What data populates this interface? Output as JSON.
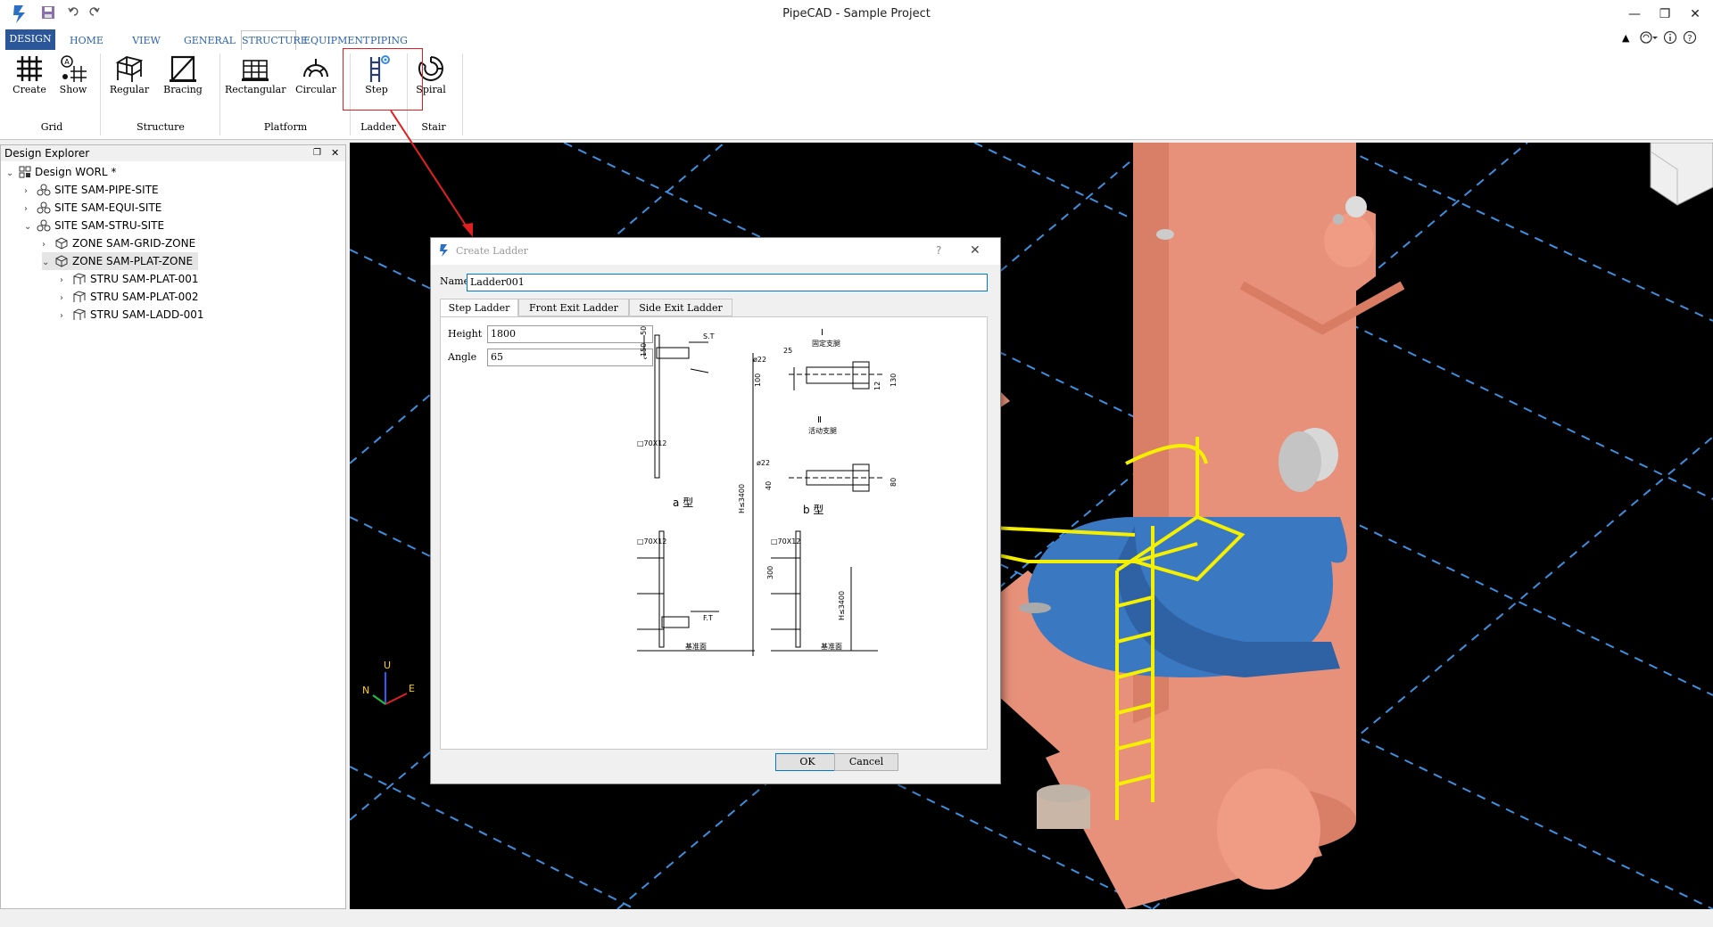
{
  "app": {
    "title": "PipeCAD - Sample Project",
    "window_controls": {
      "minimize": "—",
      "restore": "❐",
      "close": "✕"
    }
  },
  "ribbon_tabs": [
    "DESIGN",
    "HOME",
    "VIEW",
    "GENERAL",
    "STRUCTURE",
    "EQUIPMENT",
    "PIPING"
  ],
  "ribbon_active_tab": "STRUCTURE",
  "ribbon_groups": [
    {
      "name": "Grid",
      "buttons": [
        "Create",
        "Show"
      ]
    },
    {
      "name": "Structure",
      "buttons": [
        "Regular",
        "Bracing"
      ]
    },
    {
      "name": "Platform",
      "buttons": [
        "Rectangular",
        "Circular"
      ]
    },
    {
      "name": "Ladder",
      "buttons": [
        "Step"
      ]
    },
    {
      "name": "Stair",
      "buttons": [
        "Spiral"
      ]
    }
  ],
  "explorer": {
    "title": "Design Explorer",
    "tree": [
      {
        "label": "Design WORL *",
        "level": 0,
        "expanded": true,
        "icon": "world-icon"
      },
      {
        "label": "SITE SAM-PIPE-SITE",
        "level": 1,
        "expanded": false,
        "icon": "site-icon"
      },
      {
        "label": "SITE SAM-EQUI-SITE",
        "level": 1,
        "expanded": false,
        "icon": "site-icon"
      },
      {
        "label": "SITE SAM-STRU-SITE",
        "level": 1,
        "expanded": true,
        "icon": "site-icon"
      },
      {
        "label": "ZONE SAM-GRID-ZONE",
        "level": 2,
        "expanded": false,
        "icon": "zone-icon"
      },
      {
        "label": "ZONE SAM-PLAT-ZONE",
        "level": 2,
        "expanded": true,
        "icon": "zone-icon",
        "selected": true
      },
      {
        "label": "STRU SAM-PLAT-001",
        "level": 3,
        "expanded": false,
        "icon": "structure-icon"
      },
      {
        "label": "STRU SAM-PLAT-002",
        "level": 3,
        "expanded": false,
        "icon": "structure-icon"
      },
      {
        "label": "STRU SAM-LADD-001",
        "level": 3,
        "expanded": false,
        "icon": "structure-icon"
      }
    ]
  },
  "dialog": {
    "title": "Create Ladder",
    "help": "?",
    "name_label": "Name",
    "name_value": "Ladder001",
    "tabs": [
      "Step Ladder",
      "Front Exit Ladder",
      "Side Exit Ladder"
    ],
    "active_tab": "Step Ladder",
    "height_label": "Height",
    "height_value": "1800",
    "angle_label": "Angle",
    "angle_value": "65",
    "ok_label": "OK",
    "cancel_label": "Cancel",
    "drawing": {
      "labels": [
        "I",
        "固定支腿",
        "Ⅱ",
        "活动支腿",
        "a 型",
        "b 型",
        "S.T",
        "F.T",
        "□70X12",
        "H≤3400",
        "基准面",
        "ø22",
        "50",
        "150",
        "300",
        "100",
        "130",
        "80",
        "40",
        "12",
        "25",
        "1"
      ]
    }
  },
  "axis": {
    "u": "U",
    "n": "N",
    "e": "E"
  },
  "colors": {
    "accent": "#2b579a",
    "vessel": "#e8917a",
    "platform": "#3a78c2",
    "ladder": "#f5f000",
    "highlight": "#e02020"
  }
}
